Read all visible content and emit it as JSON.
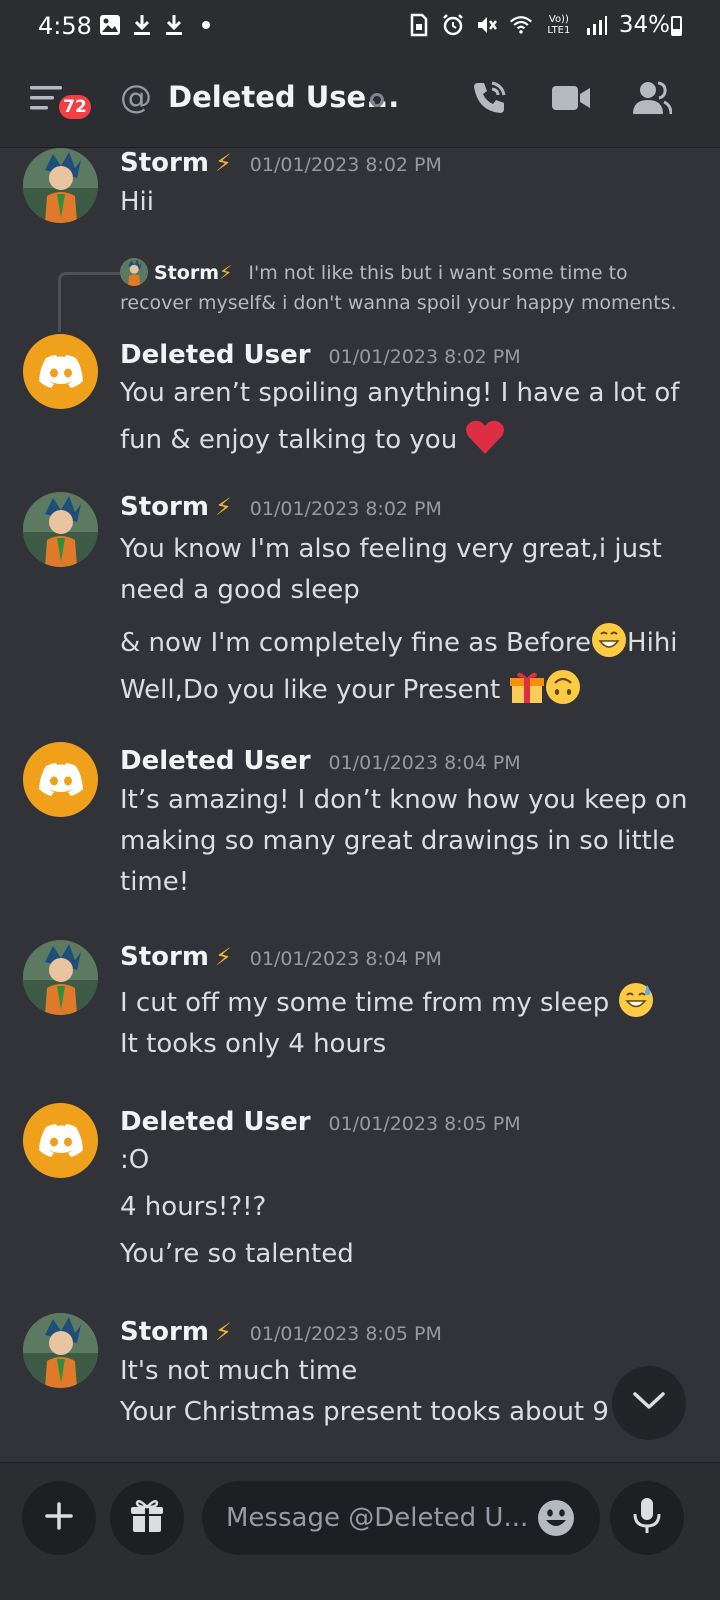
{
  "status_bar": {
    "time": "4:58",
    "network_label": "Vo)) LTE1",
    "battery_percent": "34%",
    "battery_level": 0.34,
    "icons": [
      "photo-icon",
      "download-icon",
      "download-icon",
      "dot-icon",
      "sim-icon",
      "alarm-icon",
      "mute-icon",
      "wifi-icon",
      "signal-icon",
      "battery-icon"
    ]
  },
  "header": {
    "unread_count": "72",
    "channel_prefix": "@",
    "channel_title": "Deleted Use...",
    "icons": [
      "menu-icon",
      "call-icon",
      "video-icon",
      "members-icon"
    ]
  },
  "messages": [
    {
      "author": "Storm",
      "bolt": "⚡",
      "timestamp": "01/01/2023 8:02 PM",
      "lines": [
        "Hii"
      ]
    },
    {
      "reply": {
        "author": "Storm",
        "bolt": "⚡",
        "text_line1": "I'm not like this but i want some time to",
        "text_line2": "recover myself& i don't wanna spoil your happy moments."
      },
      "author": "Deleted User",
      "timestamp": "01/01/2023 8:02 PM",
      "lines": [
        "You aren’t spoiling anything! I have a lot of",
        "fun & enjoy talking to you"
      ]
    },
    {
      "author": "Storm",
      "bolt": "⚡",
      "timestamp": "01/01/2023 8:02 PM",
      "lines": [
        "You know I'm also feeling very great,i just",
        "need a good sleep",
        "& now I'm completely fine as Before",
        "Hihi",
        "Well,Do you like your Present"
      ]
    },
    {
      "author": "Deleted User",
      "timestamp": "01/01/2023 8:04 PM",
      "lines": [
        "It’s amazing! I don’t know how you keep on",
        "making so many great drawings in so little",
        "time!"
      ]
    },
    {
      "author": "Storm",
      "bolt": "⚡",
      "timestamp": "01/01/2023 8:04 PM",
      "lines": [
        "I cut off my some time from my sleep",
        "It tooks only 4 hours"
      ]
    },
    {
      "author": "Deleted User",
      "timestamp": "01/01/2023 8:05 PM",
      "lines": [
        ":O",
        "4 hours!?!?",
        "You’re so talented"
      ]
    },
    {
      "author": "Storm",
      "bolt": "⚡",
      "timestamp": "01/01/2023 8:05 PM",
      "lines": [
        "It's not much time",
        "Your Christmas present tooks about 9 h"
      ]
    }
  ],
  "emojis": [
    "red-heart-emoji",
    "grinning-emoji",
    "gift-emoji",
    "upside-down-face-emoji",
    "sweat-smile-emoji"
  ],
  "composer": {
    "placeholder": "Message @Deleted U...",
    "icons": [
      "plus-icon",
      "gift-icon",
      "emoji-icon",
      "microphone-icon"
    ]
  },
  "colors": {
    "background": "#313338",
    "header": "#2b2d31",
    "discord_avatar": "#f0a11c",
    "badge": "#f23f43",
    "bolt": "#f0b232"
  }
}
